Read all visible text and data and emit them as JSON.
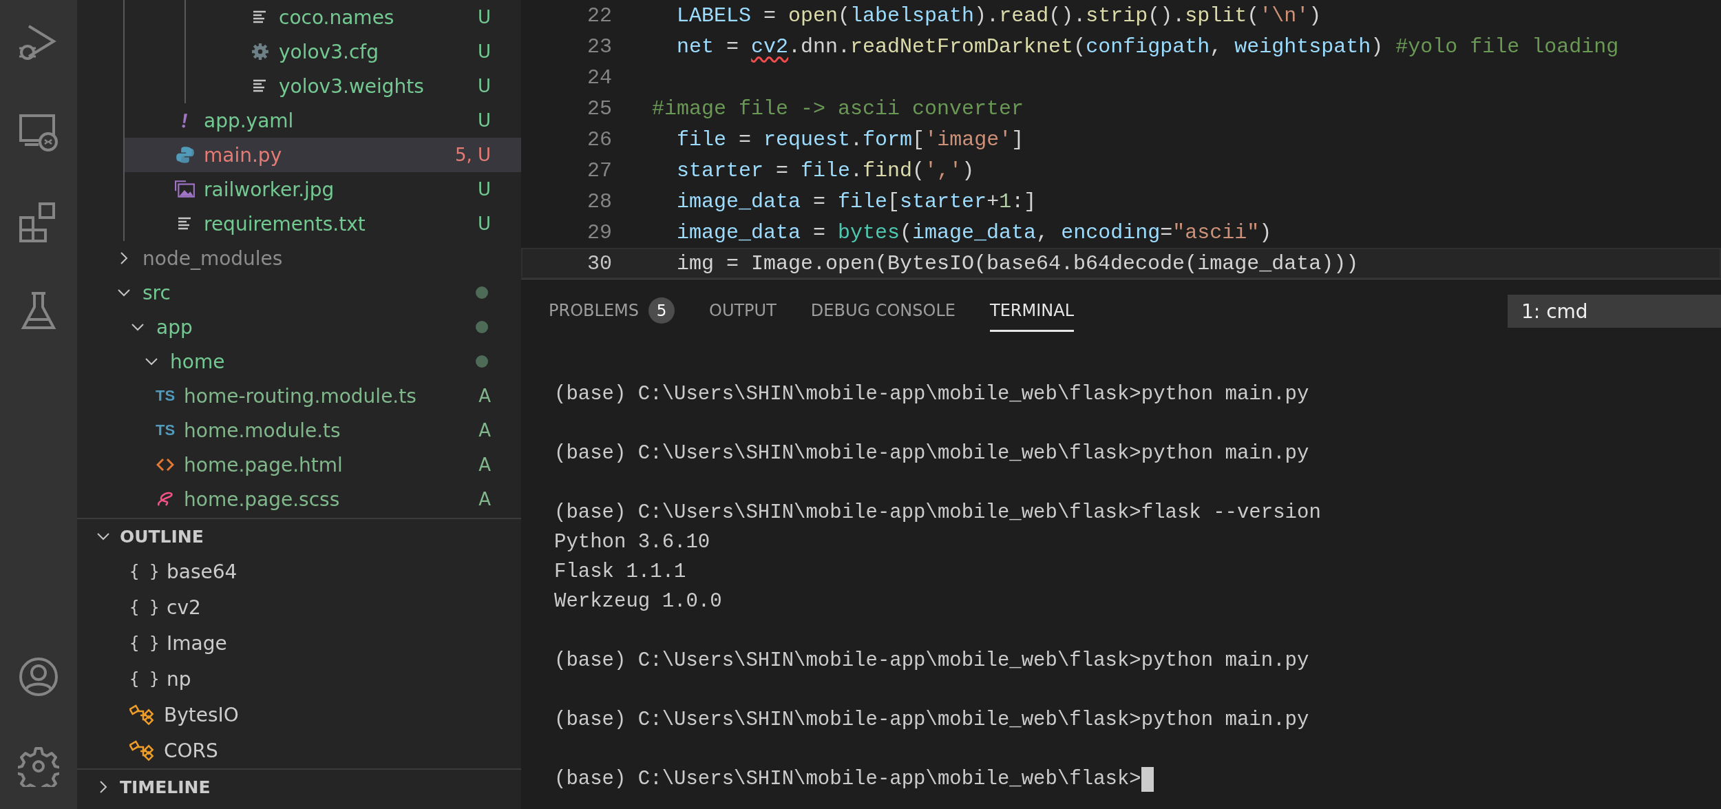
{
  "activity_bar": {
    "items": [
      {
        "kind": "debug"
      },
      {
        "kind": "remote"
      },
      {
        "kind": "extensions"
      },
      {
        "kind": "testing"
      }
    ],
    "bottom": [
      {
        "kind": "account"
      },
      {
        "kind": "settings"
      }
    ]
  },
  "explorer": {
    "items": [
      {
        "kind": "offscreen-folder",
        "children": [
          {
            "kind": "offscreen-folder",
            "children": [
              {
                "kind": "lines",
                "name": "coco.names",
                "status": "U",
                "color": "#73c991",
                "selected": false
              },
              {
                "kind": "gear",
                "name": "yolov3.cfg",
                "status": "U",
                "color": "#73c991",
                "selected": false
              },
              {
                "kind": "lines",
                "name": "yolov3.weights",
                "status": "U",
                "color": "#73c991",
                "selected": false
              }
            ]
          },
          {
            "kind": "yaml",
            "name": "app.yaml",
            "status": "U",
            "color": "#73c991",
            "selected": false
          },
          {
            "kind": "python",
            "name": "main.py",
            "status": "5, U",
            "color": "#e57c74",
            "selected": true
          },
          {
            "kind": "image",
            "name": "railworker.jpg",
            "status": "U",
            "color": "#73c991",
            "selected": false
          },
          {
            "kind": "lines",
            "name": "requirements.txt",
            "status": "U",
            "color": "#73c991",
            "selected": false
          }
        ]
      },
      {
        "kind": "folder",
        "name": "node_modules",
        "ignored": true,
        "expanded": false
      },
      {
        "kind": "folder",
        "name": "src",
        "ignored": false,
        "color": "#4d6b56",
        "expanded": true,
        "children": [
          {
            "kind": "folder",
            "name": "app",
            "ignored": false,
            "color": "#4d6b56",
            "expanded": true,
            "children": [
              {
                "kind": "folder",
                "name": "home",
                "ignored": false,
                "color": "#4d6b56",
                "expanded": true,
                "children": [
                  {
                    "kind": "ts",
                    "icon_text": "TS",
                    "name": "home-routing.module.ts",
                    "status": "A",
                    "color": "#81b88b",
                    "selected": false
                  },
                  {
                    "kind": "ts",
                    "icon_text": "TS",
                    "name": "home.module.ts",
                    "status": "A",
                    "color": "#81b88b",
                    "selected": false
                  },
                  {
                    "kind": "html",
                    "name": "home.page.html",
                    "status": "A",
                    "color": "#81b88b",
                    "selected": false
                  },
                  {
                    "kind": "scss",
                    "name": "home.page.scss",
                    "status": "A",
                    "color": "#81b88b",
                    "selected": false
                  }
                ]
              }
            ]
          }
        ]
      }
    ]
  },
  "outline": {
    "title": "OUTLINE",
    "expanded": true,
    "items": [
      {
        "kind": "module",
        "icon_text": "{ }",
        "name": "base64"
      },
      {
        "kind": "module",
        "icon_text": "{ }",
        "name": "cv2"
      },
      {
        "kind": "module",
        "icon_text": "{ }",
        "name": "Image"
      },
      {
        "kind": "module",
        "icon_text": "{ }",
        "name": "np"
      },
      {
        "kind": "class",
        "name": "BytesIO"
      },
      {
        "kind": "class",
        "name": "CORS"
      }
    ]
  },
  "timeline": {
    "title": "TIMELINE",
    "expanded": false
  },
  "editor": {
    "lines": [
      {
        "number": "22",
        "current": false,
        "tokens": [
          {
            "text": "  LABELS",
            "kind": "var"
          },
          {
            "text": " = ",
            "kind": "plain"
          },
          {
            "text": "open",
            "kind": "func"
          },
          {
            "text": "(",
            "kind": "plain"
          },
          {
            "text": "labelspath",
            "kind": "var"
          },
          {
            "text": ").",
            "kind": "plain"
          },
          {
            "text": "read",
            "kind": "func"
          },
          {
            "text": "().",
            "kind": "plain"
          },
          {
            "text": "strip",
            "kind": "func"
          },
          {
            "text": "().",
            "kind": "plain"
          },
          {
            "text": "split",
            "kind": "func"
          },
          {
            "text": "(",
            "kind": "plain"
          },
          {
            "text": "'\\n'",
            "kind": "string"
          },
          {
            "text": ")",
            "kind": "plain"
          }
        ]
      },
      {
        "number": "23",
        "current": false,
        "tokens": [
          {
            "text": "  net",
            "kind": "var"
          },
          {
            "text": " = ",
            "kind": "plain"
          },
          {
            "text": "cv2",
            "kind": "error"
          },
          {
            "text": ".dnn.",
            "kind": "plain"
          },
          {
            "text": "readNetFromDarknet",
            "kind": "func"
          },
          {
            "text": "(",
            "kind": "plain"
          },
          {
            "text": "configpath",
            "kind": "var"
          },
          {
            "text": ", ",
            "kind": "plain"
          },
          {
            "text": "weightspath",
            "kind": "var"
          },
          {
            "text": ") ",
            "kind": "plain"
          },
          {
            "text": "#yolo file loading",
            "kind": "comment"
          }
        ]
      },
      {
        "number": "24",
        "current": false
      },
      {
        "number": "25",
        "current": false,
        "tokens": [
          {
            "text": "#image file -> ascii converter",
            "kind": "comment"
          }
        ]
      },
      {
        "number": "26",
        "current": false,
        "tokens": [
          {
            "text": "  file",
            "kind": "var"
          },
          {
            "text": " = ",
            "kind": "plain"
          },
          {
            "text": "request",
            "kind": "var"
          },
          {
            "text": ".",
            "kind": "plain"
          },
          {
            "text": "form",
            "kind": "var"
          },
          {
            "text": "[",
            "kind": "plain"
          },
          {
            "text": "'image'",
            "kind": "string"
          },
          {
            "text": "]",
            "kind": "plain"
          }
        ]
      },
      {
        "number": "27",
        "current": false,
        "tokens": [
          {
            "text": "  starter",
            "kind": "var"
          },
          {
            "text": " = ",
            "kind": "plain"
          },
          {
            "text": "file",
            "kind": "var"
          },
          {
            "text": ".",
            "kind": "plain"
          },
          {
            "text": "find",
            "kind": "func"
          },
          {
            "text": "(",
            "kind": "plain"
          },
          {
            "text": "','",
            "kind": "string"
          },
          {
            "text": ")",
            "kind": "plain"
          }
        ]
      },
      {
        "number": "28",
        "current": false,
        "tokens": [
          {
            "text": "  image_data",
            "kind": "var"
          },
          {
            "text": " = ",
            "kind": "plain"
          },
          {
            "text": "file",
            "kind": "var"
          },
          {
            "text": "[",
            "kind": "plain"
          },
          {
            "text": "starter",
            "kind": "var"
          },
          {
            "text": "+",
            "kind": "plain"
          },
          {
            "text": "1",
            "kind": "number"
          },
          {
            "text": ":]",
            "kind": "plain"
          }
        ]
      },
      {
        "number": "29",
        "current": false,
        "tokens": [
          {
            "text": "  image_data",
            "kind": "var"
          },
          {
            "text": " = ",
            "kind": "plain"
          },
          {
            "text": "bytes",
            "kind": "class"
          },
          {
            "text": "(",
            "kind": "plain"
          },
          {
            "text": "image_data",
            "kind": "var"
          },
          {
            "text": ", ",
            "kind": "plain"
          },
          {
            "text": "encoding",
            "kind": "var"
          },
          {
            "text": "=",
            "kind": "plain"
          },
          {
            "text": "\"ascii\"",
            "kind": "string"
          },
          {
            "text": ")",
            "kind": "plain"
          }
        ]
      },
      {
        "number": "30",
        "current": true,
        "tokens": [
          {
            "text": "  img = Image.open(BytesIO(base64.b64decode(image_data)))",
            "kind": "plain"
          }
        ]
      }
    ]
  },
  "panel": {
    "tabs": [
      {
        "label": "PROBLEMS",
        "badge": "5",
        "selected": false
      },
      {
        "label": "OUTPUT",
        "selected": false
      },
      {
        "label": "DEBUG CONSOLE",
        "selected": false
      },
      {
        "label": "TERMINAL",
        "selected": true
      }
    ],
    "terminal_select": "1: cmd",
    "terminal_lines": [
      {
        "kind": "blank"
      },
      {
        "kind": "text",
        "text": "(base) C:\\Users\\SHIN\\mobile-app\\mobile_web\\flask>python main.py"
      },
      {
        "kind": "blank"
      },
      {
        "kind": "text",
        "text": "(base) C:\\Users\\SHIN\\mobile-app\\mobile_web\\flask>python main.py"
      },
      {
        "kind": "blank"
      },
      {
        "kind": "text",
        "text": "(base) C:\\Users\\SHIN\\mobile-app\\mobile_web\\flask>flask --version"
      },
      {
        "kind": "text",
        "text": "Python 3.6.10"
      },
      {
        "kind": "text",
        "text": "Flask 1.1.1"
      },
      {
        "kind": "text",
        "text": "Werkzeug 1.0.0"
      },
      {
        "kind": "blank"
      },
      {
        "kind": "text",
        "text": "(base) C:\\Users\\SHIN\\mobile-app\\mobile_web\\flask>python main.py"
      },
      {
        "kind": "blank"
      },
      {
        "kind": "text",
        "text": "(base) C:\\Users\\SHIN\\mobile-app\\mobile_web\\flask>python main.py"
      },
      {
        "kind": "blank"
      },
      {
        "kind": "prompt",
        "text": "(base) C:\\Users\\SHIN\\mobile-app\\mobile_web\\flask>"
      }
    ]
  }
}
